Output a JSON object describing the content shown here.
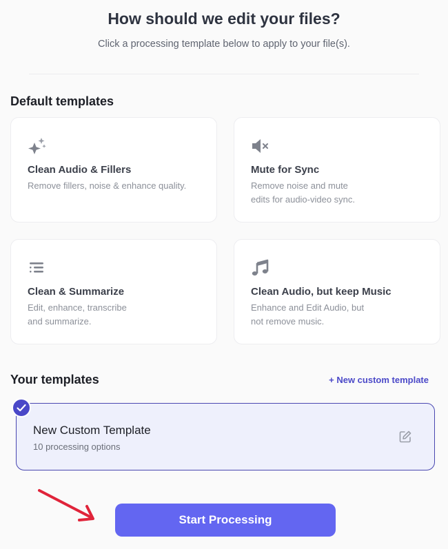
{
  "header": {
    "title": "How should we edit your files?",
    "subtitle": "Click a processing template below to apply to your file(s)."
  },
  "default_templates": {
    "heading": "Default templates",
    "items": [
      {
        "icon": "sparkles-icon",
        "title": "Clean Audio & Fillers",
        "description": "Remove fillers, noise & enhance quality."
      },
      {
        "icon": "speaker-mute-icon",
        "title": "Mute for Sync",
        "description": "Remove noise and mute edits for audio-video sync."
      },
      {
        "icon": "list-icon",
        "title": "Clean & Summarize",
        "description": "Edit, enhance, transcribe and summarize."
      },
      {
        "icon": "music-note-icon",
        "title": "Clean Audio, but keep Music",
        "description": "Enhance and Edit Audio, but not remove music."
      }
    ]
  },
  "your_templates": {
    "heading": "Your templates",
    "add_label": "+ New custom template",
    "items": [
      {
        "title": "New Custom Template",
        "subtitle": "10 processing options",
        "selected": true
      }
    ]
  },
  "footer": {
    "start_label": "Start Processing"
  },
  "colors": {
    "accent": "#6366f1",
    "selected_border": "#4846b0",
    "selected_bg": "#eef0fc",
    "annotation_arrow": "#e0243a"
  }
}
